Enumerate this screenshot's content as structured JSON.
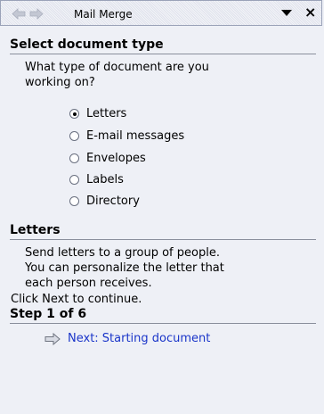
{
  "title_bar": {
    "title": "Mail Merge",
    "back_icon": "arrow-left-icon",
    "forward_icon": "arrow-right-icon",
    "menu_icon": "chevron-down-icon",
    "close_icon": "close-icon",
    "close_glyph": "×"
  },
  "select_type": {
    "heading": "Select document type",
    "question_line1": "What type of document are you",
    "question_line2": "working on?",
    "options": [
      {
        "label": "Letters",
        "selected": true
      },
      {
        "label": "E-mail messages",
        "selected": false
      },
      {
        "label": "Envelopes",
        "selected": false
      },
      {
        "label": "Labels",
        "selected": false
      },
      {
        "label": "Directory",
        "selected": false
      }
    ]
  },
  "letters_section": {
    "heading": "Letters",
    "line1": "Send letters to a group of people.",
    "line2": "You can personalize the letter that",
    "line3": "each person receives."
  },
  "footer": {
    "instruction": "Click Next to continue.",
    "step": "Step 1 of 6",
    "next_label": "Next: Starting document",
    "next_icon": "arrow-right-icon"
  },
  "colors": {
    "panel_bg": "#eef0f6",
    "link": "#1a35c9"
  }
}
